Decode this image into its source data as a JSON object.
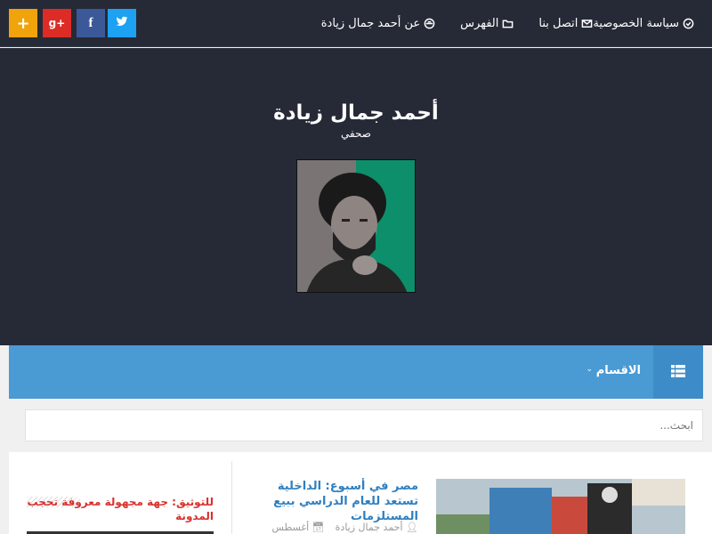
{
  "nav": {
    "items": [
      {
        "label": "عن أحمد جمال زيادة",
        "icon": "user-secret-icon"
      },
      {
        "label": "الفهرس",
        "icon": "folder-icon"
      },
      {
        "label": "اتصل بنا",
        "icon": "envelope-icon"
      },
      {
        "label": "سياسة الخصوصية",
        "icon": "check-circle-icon"
      }
    ],
    "social": [
      {
        "label": "+",
        "icon": "plus-icon",
        "color": "#f0a30a"
      },
      {
        "label": "g+",
        "icon": "google-plus-icon",
        "color": "#dd2c25"
      },
      {
        "label": "f",
        "icon": "facebook-icon",
        "color": "#3b5998"
      },
      {
        "label": "",
        "icon": "twitter-icon",
        "color": "#1da1f2"
      }
    ]
  },
  "header": {
    "title": "أحمد جمال زيادة",
    "description": "صحفي"
  },
  "categories": {
    "label": "الاقسام",
    "icon": "list-icon"
  },
  "search": {
    "placeholder": "ابحث..."
  },
  "post": {
    "title": "مصر في أسبوع: الداخلية تستعد للعام الدراسي ببيع المستلزمات",
    "author": "أحمد جمال زيادة",
    "date": "أغسطس"
  },
  "sidebar": {
    "title": "للتوثيق: جهة مجهولة معروفة تحجب المدونة"
  },
  "colors": {
    "topbar": "#262a36",
    "accent_blue": "#4a9ad4",
    "link_blue": "#2f7fc0",
    "red": "#d9302c"
  }
}
